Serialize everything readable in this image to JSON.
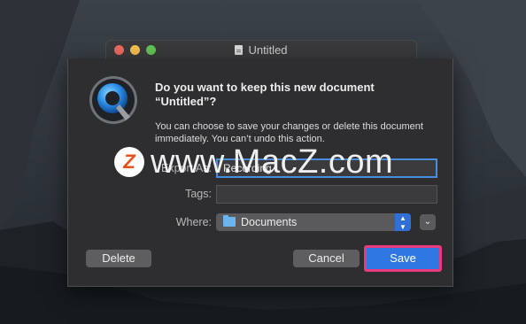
{
  "window": {
    "title": "Untitled"
  },
  "dialog": {
    "headline": "Do you want to keep this new document “Untitled”?",
    "message": "You can choose to save your changes or delete this document immediately. You can’t undo this action.",
    "save_as_label": "Export As:",
    "save_as_value": "Recording",
    "tags_label": "Tags:",
    "tags_value": "",
    "where_label": "Where:",
    "where_value": "Documents",
    "delete_label": "Delete",
    "cancel_label": "Cancel",
    "save_label": "Save",
    "expand_glyph": "⌄"
  },
  "icons": {
    "app": "quicktime-icon",
    "document": "document-icon",
    "folder": "folder-icon"
  },
  "watermark": {
    "letter": "Z",
    "text": "www.MacZ.com"
  },
  "colors": {
    "accent": "#2f78e3",
    "highlight": "#e83a7c"
  }
}
